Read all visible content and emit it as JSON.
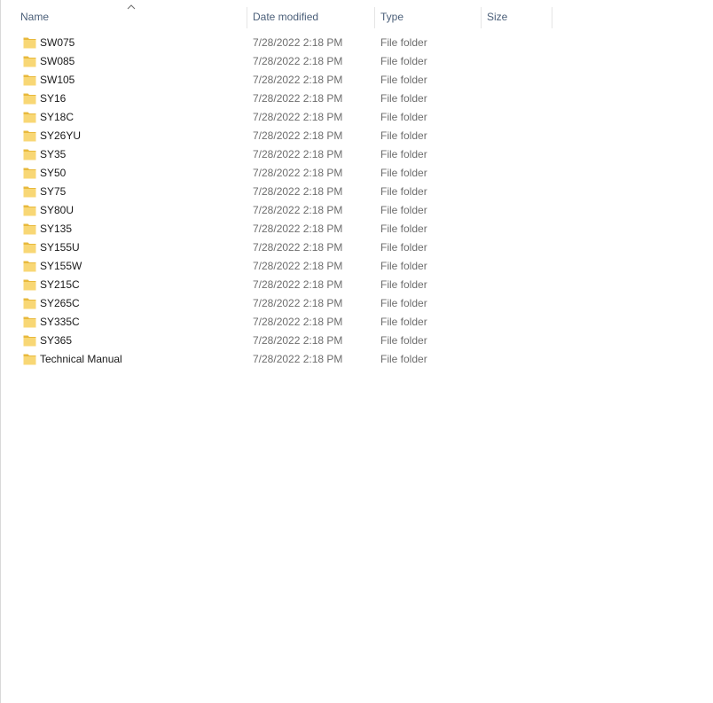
{
  "columns": {
    "name": "Name",
    "date": "Date modified",
    "type": "Type",
    "size": "Size"
  },
  "sort": {
    "column": "name",
    "direction": "ascending"
  },
  "colors": {
    "folder_body": "#f8d775",
    "folder_tab": "#e8b93c",
    "header_text": "#4c607a",
    "meta_text": "#6d6d6d"
  },
  "rows": [
    {
      "name": "SW075",
      "date": "7/28/2022 2:18 PM",
      "type": "File folder",
      "size": ""
    },
    {
      "name": "SW085",
      "date": "7/28/2022 2:18 PM",
      "type": "File folder",
      "size": ""
    },
    {
      "name": "SW105",
      "date": "7/28/2022 2:18 PM",
      "type": "File folder",
      "size": ""
    },
    {
      "name": "SY16",
      "date": "7/28/2022 2:18 PM",
      "type": "File folder",
      "size": ""
    },
    {
      "name": "SY18C",
      "date": "7/28/2022 2:18 PM",
      "type": "File folder",
      "size": ""
    },
    {
      "name": "SY26YU",
      "date": "7/28/2022 2:18 PM",
      "type": "File folder",
      "size": ""
    },
    {
      "name": "SY35",
      "date": "7/28/2022 2:18 PM",
      "type": "File folder",
      "size": ""
    },
    {
      "name": "SY50",
      "date": "7/28/2022 2:18 PM",
      "type": "File folder",
      "size": ""
    },
    {
      "name": "SY75",
      "date": "7/28/2022 2:18 PM",
      "type": "File folder",
      "size": ""
    },
    {
      "name": "SY80U",
      "date": "7/28/2022 2:18 PM",
      "type": "File folder",
      "size": ""
    },
    {
      "name": "SY135",
      "date": "7/28/2022 2:18 PM",
      "type": "File folder",
      "size": ""
    },
    {
      "name": "SY155U",
      "date": "7/28/2022 2:18 PM",
      "type": "File folder",
      "size": ""
    },
    {
      "name": "SY155W",
      "date": "7/28/2022 2:18 PM",
      "type": "File folder",
      "size": ""
    },
    {
      "name": "SY215C",
      "date": "7/28/2022 2:18 PM",
      "type": "File folder",
      "size": ""
    },
    {
      "name": "SY265C",
      "date": "7/28/2022 2:18 PM",
      "type": "File folder",
      "size": ""
    },
    {
      "name": "SY335C",
      "date": "7/28/2022 2:18 PM",
      "type": "File folder",
      "size": ""
    },
    {
      "name": "SY365",
      "date": "7/28/2022 2:18 PM",
      "type": "File folder",
      "size": ""
    },
    {
      "name": "Technical Manual",
      "date": "7/28/2022 2:18 PM",
      "type": "File folder",
      "size": ""
    }
  ]
}
